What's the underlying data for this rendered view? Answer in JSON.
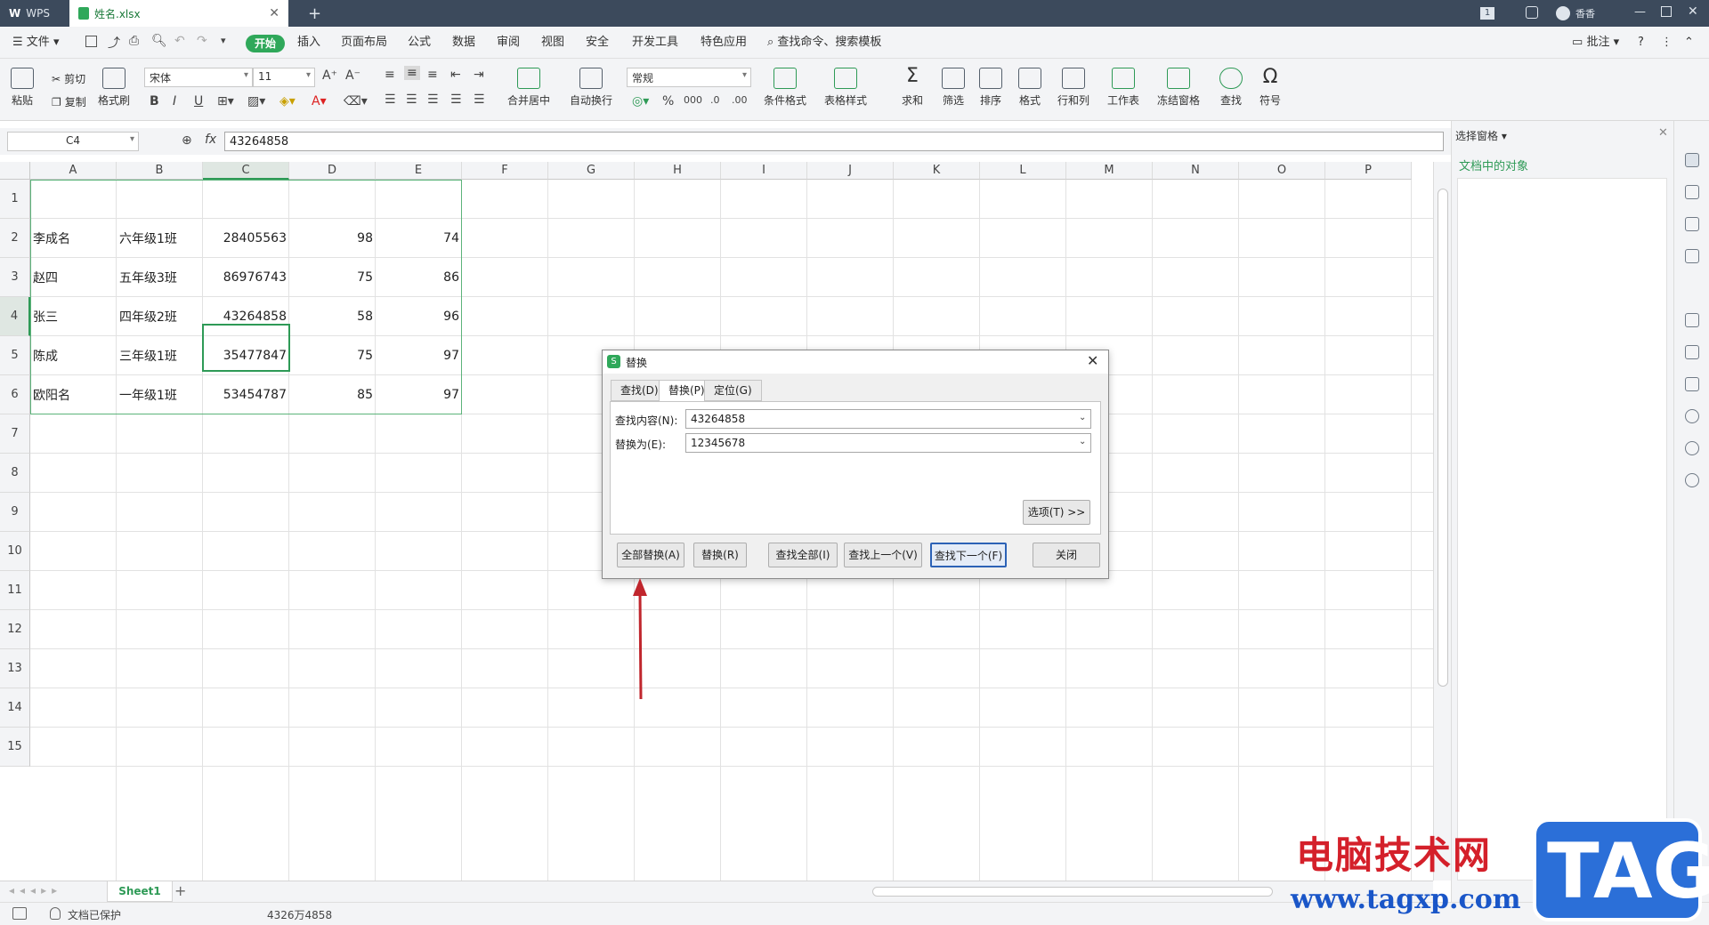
{
  "titlebar": {
    "app_tab": "WPS",
    "file_tab": "姓名.xlsx",
    "new_tab_symbol": "+",
    "page_badge": "1",
    "user_name": "香香"
  },
  "menubar": {
    "file": "文件",
    "tabs": [
      "开始",
      "插入",
      "页面布局",
      "公式",
      "数据",
      "审阅",
      "视图",
      "安全",
      "开发工具",
      "特色应用"
    ],
    "search": "查找命令、搜索模板",
    "comment": "批注"
  },
  "ribbon": {
    "paste": "粘贴",
    "cut": "剪切",
    "copy": "复制",
    "format_painter": "格式刷",
    "font_name": "宋体",
    "font_size": "11",
    "merge_center": "合并居中",
    "wrap": "自动换行",
    "number_format": "常规",
    "cond_format": "条件格式",
    "table_style": "表格样式",
    "sum": "求和",
    "filter": "筛选",
    "sort": "排序",
    "format": "格式",
    "row_col": "行和列",
    "worksheet": "工作表",
    "freeze": "冻结窗格",
    "find": "查找",
    "symbol": "符号"
  },
  "formula_bar": {
    "name_box": "C4",
    "fx": "fx",
    "value": "43264858"
  },
  "grid": {
    "columns": [
      "A",
      "B",
      "C",
      "D",
      "E",
      "F",
      "G",
      "H",
      "I",
      "J",
      "K",
      "L",
      "M",
      "N",
      "O",
      "P"
    ],
    "rows": [
      "1",
      "2",
      "3",
      "4",
      "5",
      "6",
      "7",
      "8",
      "9",
      "10",
      "11",
      "12",
      "13",
      "14",
      "15"
    ],
    "data": [
      [
        "李成名",
        "六年级1班",
        "28405563",
        "98",
        "74"
      ],
      [
        "赵四",
        "五年级3班",
        "86976743",
        "75",
        "86"
      ],
      [
        "张三",
        "四年级2班",
        "43264858",
        "58",
        "96"
      ],
      [
        "陈成",
        "三年级1班",
        "35477847",
        "75",
        "97"
      ],
      [
        "欧阳名",
        "一年级1班",
        "53454787",
        "85",
        "97"
      ]
    ]
  },
  "sheet": {
    "tab": "Sheet1",
    "add": "+"
  },
  "status": {
    "protect": "文档已保护",
    "value": "4326万4858"
  },
  "side_panel": {
    "title": "选择窗格",
    "subtitle": "文档中的对象"
  },
  "dialog": {
    "title": "替换",
    "tabs": [
      "查找(D)",
      "替换(P)",
      "定位(G)"
    ],
    "find_label": "查找内容(N):",
    "find_value": "43264858",
    "replace_label": "替换为(E):",
    "replace_value": "12345678",
    "options_button": "选项(T) >>",
    "buttons": [
      "全部替换(A)",
      "替换(R)",
      "查找全部(I)",
      "查找上一个(V)",
      "查找下一个(F)",
      "关闭"
    ]
  },
  "watermark": {
    "site_title": "电脑技术网",
    "url": "www.tagxp.com",
    "logo": "TAG"
  },
  "colors": {
    "accent_green": "#2fa85a",
    "titlebar": "#3c4a5c",
    "arrow_red": "#c0262d"
  }
}
